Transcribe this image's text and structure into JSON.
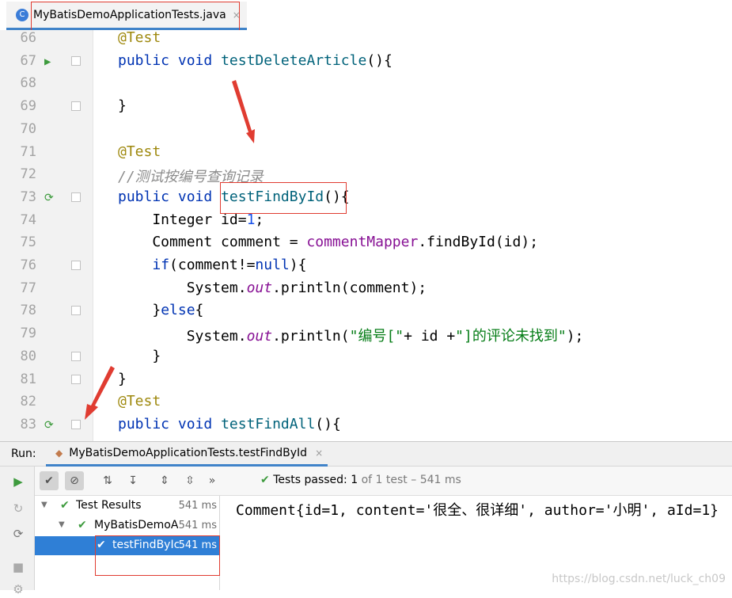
{
  "editor_tab": {
    "icon": "C",
    "label": "MyBatisDemoApplicationTests.java",
    "close": "×"
  },
  "code_lines": [
    {
      "n": "66",
      "html": "<span class=\"ann\">@Test</span>"
    },
    {
      "n": "67",
      "html": "<span class=\"kw\">public</span> <span class=\"kw\">void</span> <span class=\"fn\">testDeleteArticle</span>(){"
    },
    {
      "n": "68",
      "html": ""
    },
    {
      "n": "69",
      "html": "}"
    },
    {
      "n": "70",
      "html": ""
    },
    {
      "n": "71",
      "html": "<span class=\"ann\">@Test</span>"
    },
    {
      "n": "72",
      "html": "<span class=\"cmt\">//测试按编号查询记录</span>"
    },
    {
      "n": "73",
      "html": "<span class=\"kw\">public</span> <span class=\"kw\">void</span> <span class=\"fn\">testFindById</span>(){"
    },
    {
      "n": "74",
      "html": "    Integer id=<span class=\"num\">1</span>;"
    },
    {
      "n": "75",
      "html": "    Comment comment = <span class=\"fld\">commentMapper</span>.findById(id);"
    },
    {
      "n": "76",
      "html": "    <span class=\"kw\">if</span>(comment!=<span class=\"kw\">null</span>){"
    },
    {
      "n": "77",
      "html": "        System.<span class=\"stat\">out</span>.println(comment);"
    },
    {
      "n": "78",
      "html": "    }<span class=\"kw\">else</span>{"
    },
    {
      "n": "79",
      "html": "        System.<span class=\"stat\">out</span>.println(<span class=\"str\">\"编号[\"</span>+ id +<span class=\"str\">\"]的评论未找到\"</span>);"
    },
    {
      "n": "80",
      "html": "    }"
    },
    {
      "n": "81",
      "html": "}"
    },
    {
      "n": "82",
      "html": "<span class=\"ann\">@Test</span>"
    },
    {
      "n": "83",
      "html": "<span class=\"kw\">public</span> <span class=\"kw\">void</span> <span class=\"fn\">testFindAll</span>(){"
    }
  ],
  "run_panel": {
    "label": "Run:",
    "tab_label": "MyBatisDemoApplicationTests.testFindById",
    "tab_close": "×"
  },
  "toolbar": {
    "status_prefix": "Tests passed:",
    "status_count": "1",
    "status_suffix": "of 1 test – 541 ms"
  },
  "tree": [
    {
      "label": "Test Results",
      "time": "541 ms"
    },
    {
      "label": "MyBatisDemoA",
      "time": "541 ms"
    },
    {
      "label": "testFindByIc",
      "time": "541 ms"
    }
  ],
  "console": {
    "output": "Comment{id=1, content='很全、很详细', author='小明', aId=1}"
  },
  "watermark": "https://blog.csdn.net/luck_ch09",
  "colors": {
    "keyword": "#0033b3",
    "annotation": "#9e880d",
    "selection": "#2f7fd6",
    "pass": "#3e9b3e",
    "highlight_box": "#e03c31"
  }
}
